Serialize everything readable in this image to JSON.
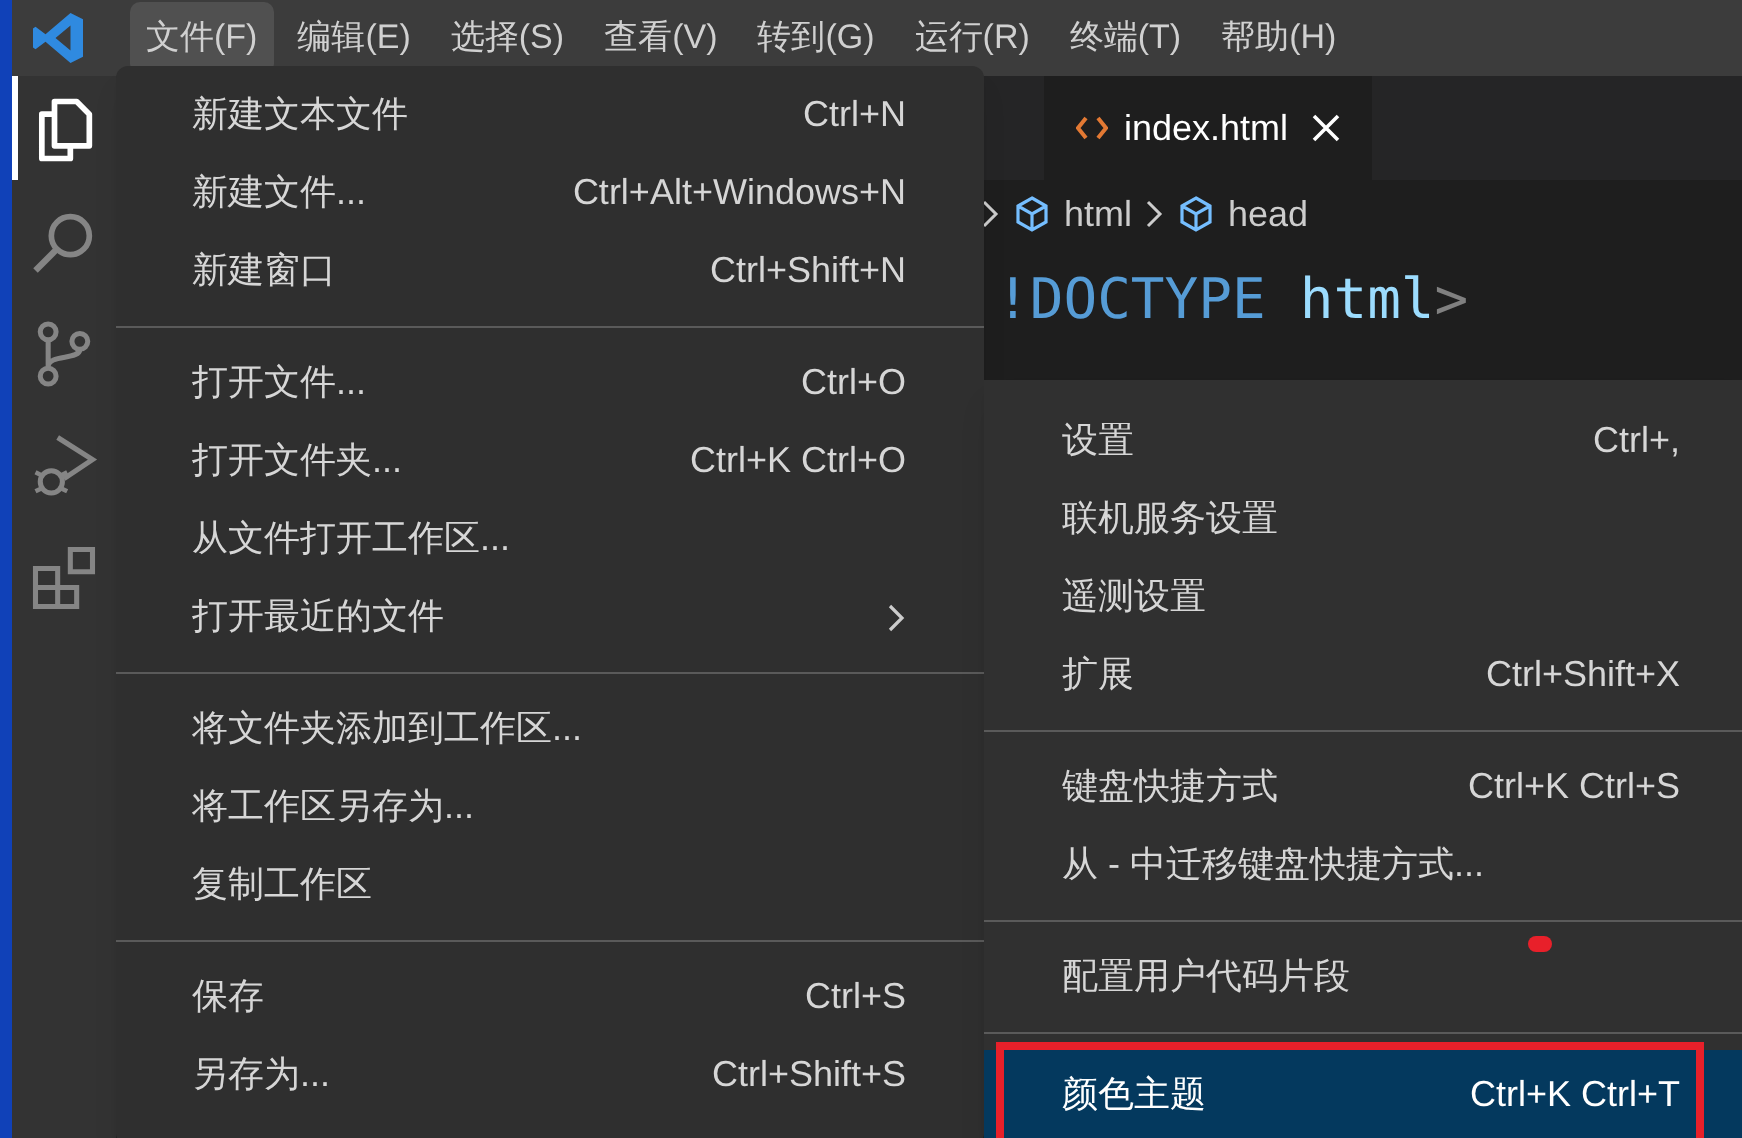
{
  "menu_bar": [
    {
      "label": "文件(F)",
      "selected": true
    },
    {
      "label": "编辑(E)",
      "selected": false
    },
    {
      "label": "选择(S)",
      "selected": false
    },
    {
      "label": "查看(V)",
      "selected": false
    },
    {
      "label": "转到(G)",
      "selected": false
    },
    {
      "label": "运行(R)",
      "selected": false
    },
    {
      "label": "终端(T)",
      "selected": false
    },
    {
      "label": "帮助(H)",
      "selected": false
    }
  ],
  "activity_bar": [
    {
      "kind": "files",
      "selected": true
    },
    {
      "kind": "search",
      "selected": false
    },
    {
      "kind": "branch",
      "selected": false
    },
    {
      "kind": "debug",
      "selected": false
    },
    {
      "kind": "blocks",
      "selected": false
    }
  ],
  "editor": {
    "tab": {
      "label": "index.html"
    },
    "breadcrumb": [
      "html",
      "head"
    ],
    "code_lines": [
      [
        {
          "text": "!DOCTYPE",
          "kind": "tag"
        },
        {
          "text": "html",
          "kind": "attr"
        },
        {
          "text": ">",
          "kind": "punct"
        }
      ]
    ]
  },
  "file_menu": {
    "groups": [
      [
        {
          "label": "新建文本文件",
          "shortcut": "Ctrl+N"
        },
        {
          "label": "新建文件...",
          "shortcut": "Ctrl+Alt+Windows+N"
        },
        {
          "label": "新建窗口",
          "shortcut": "Ctrl+Shift+N"
        }
      ],
      [
        {
          "label": "打开文件...",
          "shortcut": "Ctrl+O"
        },
        {
          "label": "打开文件夹...",
          "shortcut": "Ctrl+K Ctrl+O"
        },
        {
          "label": "从文件打开工作区..."
        },
        {
          "label": "打开最近的文件",
          "submenu": true
        }
      ],
      [
        {
          "label": "将文件夹添加到工作区..."
        },
        {
          "label": "将工作区另存为..."
        },
        {
          "label": "复制工作区"
        }
      ],
      [
        {
          "label": "保存",
          "shortcut": "Ctrl+S"
        },
        {
          "label": "另存为...",
          "shortcut": "Ctrl+Shift+S"
        }
      ]
    ]
  },
  "preferences_menu": {
    "groups": [
      [
        {
          "label": "设置",
          "shortcut": "Ctrl+,",
          "selected": false
        },
        {
          "label": "联机服务设置",
          "selected": false
        },
        {
          "label": "遥测设置",
          "selected": false
        },
        {
          "label": "扩展",
          "shortcut": "Ctrl+Shift+X",
          "selected": false
        }
      ],
      [
        {
          "label": "键盘快捷方式",
          "shortcut": "Ctrl+K Ctrl+S",
          "selected": false
        },
        {
          "label": "从 - 中迁移键盘快捷方式...",
          "selected": false
        }
      ],
      [
        {
          "label": "配置用户代码片段",
          "selected": false,
          "marked": true
        }
      ],
      [
        {
          "label": "颜色主题",
          "shortcut": "Ctrl+K Ctrl+T",
          "selected": true,
          "highlighted": true
        }
      ]
    ]
  }
}
